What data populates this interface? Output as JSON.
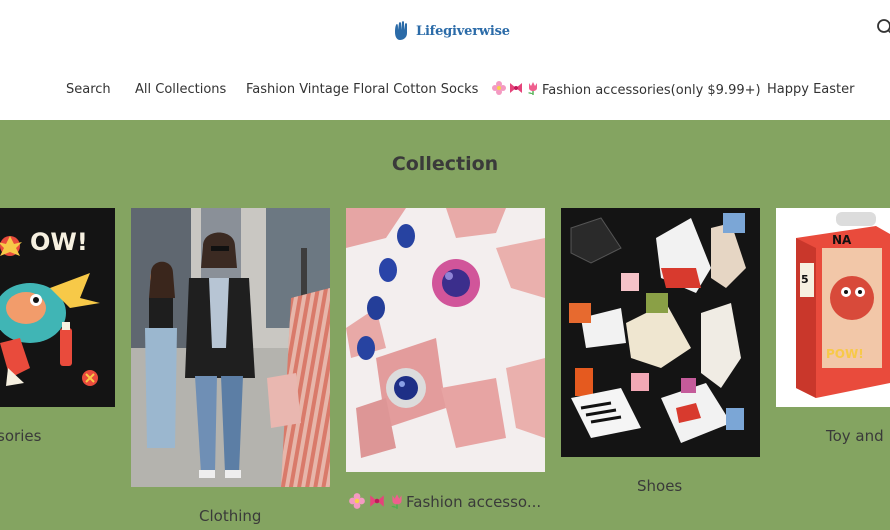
{
  "header": {
    "logo_text": "Lifegiverwise",
    "logo_icon": "hand-logo-icon",
    "search_icon": "search-icon"
  },
  "nav": {
    "items": [
      {
        "label": "Search"
      },
      {
        "label": "All Collections"
      },
      {
        "label": "Fashion Vintage Floral Cotton Socks"
      },
      {
        "label": "Fashion accessories(only $9.99+)",
        "icons": [
          "flower-icon",
          "bow-icon",
          "tulip-icon"
        ]
      },
      {
        "label": "Happy Easter"
      }
    ]
  },
  "collection": {
    "title": "Collection",
    "background_color": "#84a461",
    "cards": [
      {
        "label": "essories",
        "image": "cartoon-rooster-illustration"
      },
      {
        "label": "Clothing",
        "image": "street-fashion-photo"
      },
      {
        "label": "Fashion accesso...",
        "image": "jewelry-on-pink-rocks",
        "icons": [
          "flower-icon",
          "bow-icon",
          "tulip-icon"
        ]
      },
      {
        "label": "Shoes",
        "image": "shoe-collage"
      },
      {
        "label": "Toy and",
        "image": "toy-box-package"
      }
    ]
  }
}
